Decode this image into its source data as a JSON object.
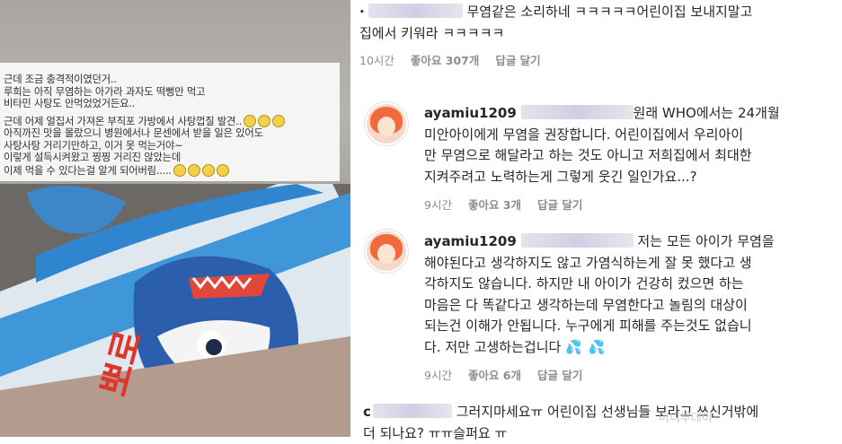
{
  "photo": {
    "caption_lines": [
      "근데 조금 충격적이였던거..",
      "루희는 아직 무염하는 아가라 과자도 떡뻥만 먹고",
      "비타민 사탕도 안먹었었거든요..",
      "근데 어제 얼집서 가져온 부직포 가방에서 사탕껍질 발견..",
      "아직까진 맛을 몰랐으니 병원에서나 문센에서 받을 일은 있어도",
      "사탕사탕 거리기만하고, 이거 못 먹는거야~",
      "이렇게 설득시켜왔고 찡찡 거리진 않았는데",
      "이제 먹을 수 있다는걸 알게 되어버림....."
    ],
    "pack_text": "뽀로"
  },
  "comments": [
    {
      "text_lines": [
        "무염같은 소리하네 ㅋㅋㅋㅋㅋ어린이집 보내지말고",
        "집에서 키워라 ㅋㅋㅋㅋㅋ"
      ],
      "time": "10시간",
      "likes": "좋아요 307개",
      "reply": "답글 달기"
    },
    {
      "username": "ayamiu1209",
      "text_lines": [
        "원래 WHO에서는 24개월",
        "미안아이에게 무염을 권장합니다. 어린이집에서 우리아이",
        "만 무염으로 해달라고 하는 것도 아니고 저희집에서 최대한",
        "지켜주려고 노력하는게 그렇게 웃긴 일인가요...?"
      ],
      "time": "9시간",
      "likes": "좋아요 3개",
      "reply": "답글 달기"
    },
    {
      "username": "ayamiu1209",
      "text_lines": [
        "저는 모든 아이가 무염을",
        "해야된다고 생각하지도 않고 가염식하는게 잘 못 했다고 생",
        "각하지도 않습니다. 하지만 내 아이가 건강히 컸으면 하는",
        "마음은 다 똑같다고 생각하는데 무염한다고 놀림의 대상이",
        "되는건 이해가 안됩니다. 누구에게 피해를 주는것도 없습니",
        "다. 저만 고생하는겁니다"
      ],
      "time": "9시간",
      "likes": "좋아요 6개",
      "reply": "답글 달기"
    },
    {
      "username_initial": "c",
      "text_lines": [
        "그러지마세요ㅠ 어린이집 선생님들 보라고 쓰신거밖에",
        "더 되나요? ㅠㅠ슬퍼요 ㅠ"
      ]
    }
  ],
  "watermark": "머니투데이"
}
